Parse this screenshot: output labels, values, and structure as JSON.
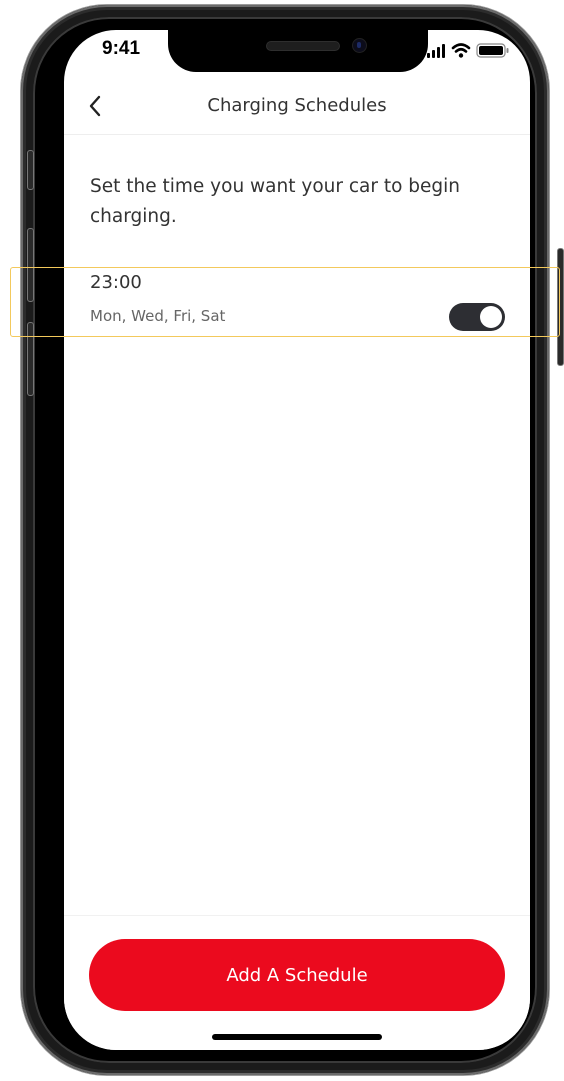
{
  "status_bar": {
    "time": "9:41",
    "icons": [
      "signal-icon",
      "wifi-icon",
      "battery-icon"
    ]
  },
  "header": {
    "back_icon": "chevron-left-icon",
    "title": "Charging Schedules"
  },
  "intro": {
    "text": "Set the time you want your car to begin charging."
  },
  "schedules": [
    {
      "time": "23:00",
      "days": "Mon, Wed, Fri, Sat",
      "enabled": true
    }
  ],
  "footer": {
    "add_button_label": "Add A Schedule"
  },
  "colors": {
    "accent": "#eb0a1e",
    "toggle_on": "#2d2e33",
    "highlight": "#f3c95c",
    "text": "#333333"
  }
}
